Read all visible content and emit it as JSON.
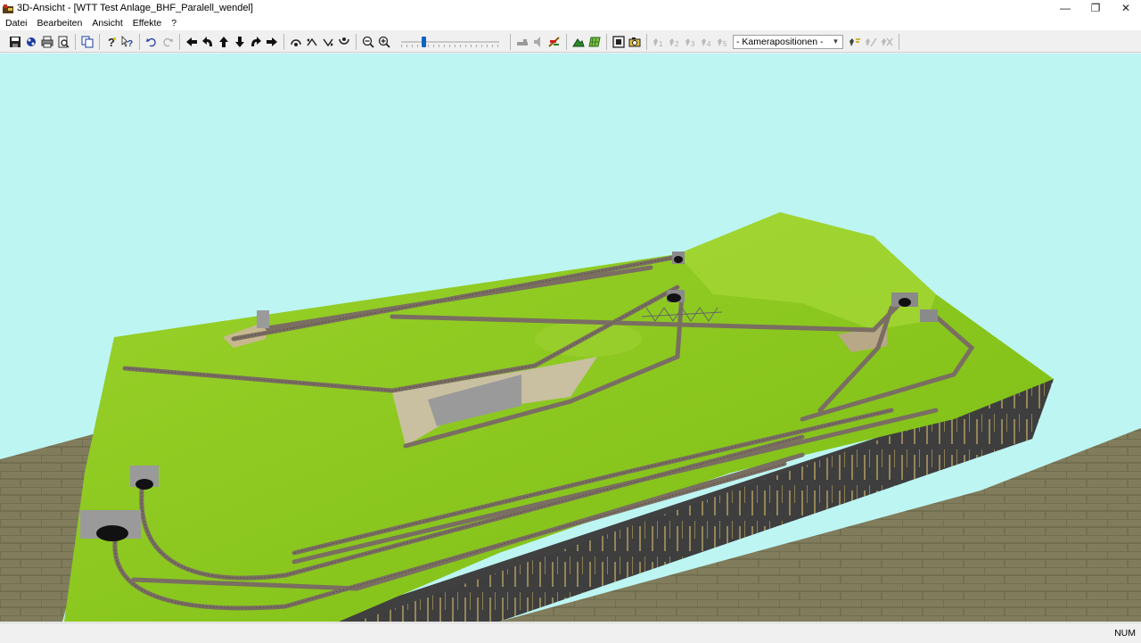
{
  "window": {
    "title": "3D-Ansicht - [WTT Test Anlage_BHF_Paralell_wendel]",
    "controls": [
      "minimize-icon",
      "restore-icon",
      "close-icon"
    ],
    "glyphs": {
      "minimize": "—",
      "restore": "❐",
      "close": "✕"
    }
  },
  "menu": {
    "items": [
      "Datei",
      "Bearbeiten",
      "Ansicht",
      "Effekte",
      "?"
    ]
  },
  "toolbar": {
    "camera_select": {
      "selected": "- Kamerapositionen -"
    },
    "buttons": [
      "save-icon",
      "print-preview-icon",
      "print-icon",
      "zoom-page-icon",
      "copy-icon",
      "help-icon",
      "context-help-icon",
      "undo-icon",
      "redo-icon",
      "arrow-left-icon",
      "rotate-left-icon",
      "arrow-up-icon",
      "arrow-down-icon",
      "rotate-right-icon",
      "arrow-right-icon",
      "tilt-up-icon",
      "tilt-left-icon",
      "tilt-right-icon",
      "tilt-down-icon",
      "zoom-out-icon",
      "zoom-in-icon",
      "train-icon",
      "sound-icon",
      "signal-icon",
      "landscape-icon",
      "grid-icon",
      "fullscreen-icon",
      "camera-icon",
      "camera-1-icon",
      "camera-2-icon",
      "camera-3-icon",
      "camera-4-icon",
      "camera-5-icon",
      "camera-set-icon",
      "camera-edit-icon",
      "camera-delete-icon"
    ],
    "speed_slider": {
      "value": 0.22
    }
  },
  "viewport": {
    "scene": "3D model railway layout",
    "colors": {
      "sky": "#bdf5f3",
      "grass": "#8cc81e",
      "floor": "#7d7a5a",
      "baseboard": "#3f3f3f",
      "track": "#7a6e62"
    }
  },
  "status": {
    "num": "NUM"
  }
}
